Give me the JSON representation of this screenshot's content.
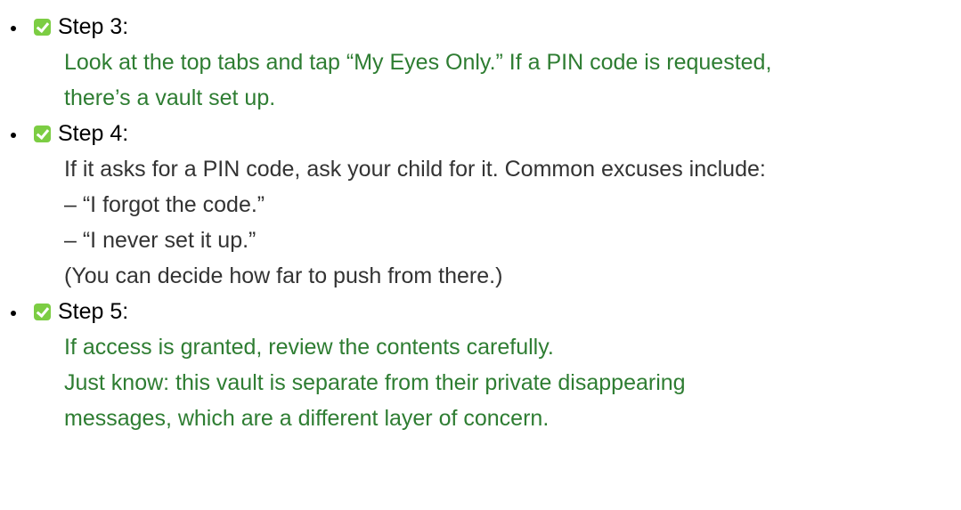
{
  "steps": [
    {
      "title": "Step 3:",
      "lines": [
        {
          "text": "Look at the top tabs and tap “My Eyes Only.” If a PIN code is requested,",
          "tone": "green"
        },
        {
          "text": "there’s a vault set up.",
          "tone": "green"
        }
      ]
    },
    {
      "title": "Step 4:",
      "lines": [
        {
          "text": "If it asks for a PIN code, ask your child for it. Common excuses include:",
          "tone": "dark"
        },
        {
          "text": "– “I forgot the code.”",
          "tone": "dark"
        },
        {
          "text": "– “I never set it up.”",
          "tone": "dark"
        },
        {
          "text": "(You can decide how far to push from there.)",
          "tone": "dark"
        }
      ]
    },
    {
      "title": "Step 5:",
      "lines": [
        {
          "text": "If access is granted, review the contents carefully.",
          "tone": "green"
        },
        {
          "text": "Just know: this vault is separate from their private disappearing",
          "tone": "green"
        },
        {
          "text": "messages, which are a different layer of concern.",
          "tone": "green"
        }
      ]
    }
  ],
  "icons": {
    "step_check": "check-box-icon"
  },
  "colors": {
    "green_text": "#2e7d32",
    "dark_text": "#333333",
    "check_bg": "#7ccd43"
  }
}
